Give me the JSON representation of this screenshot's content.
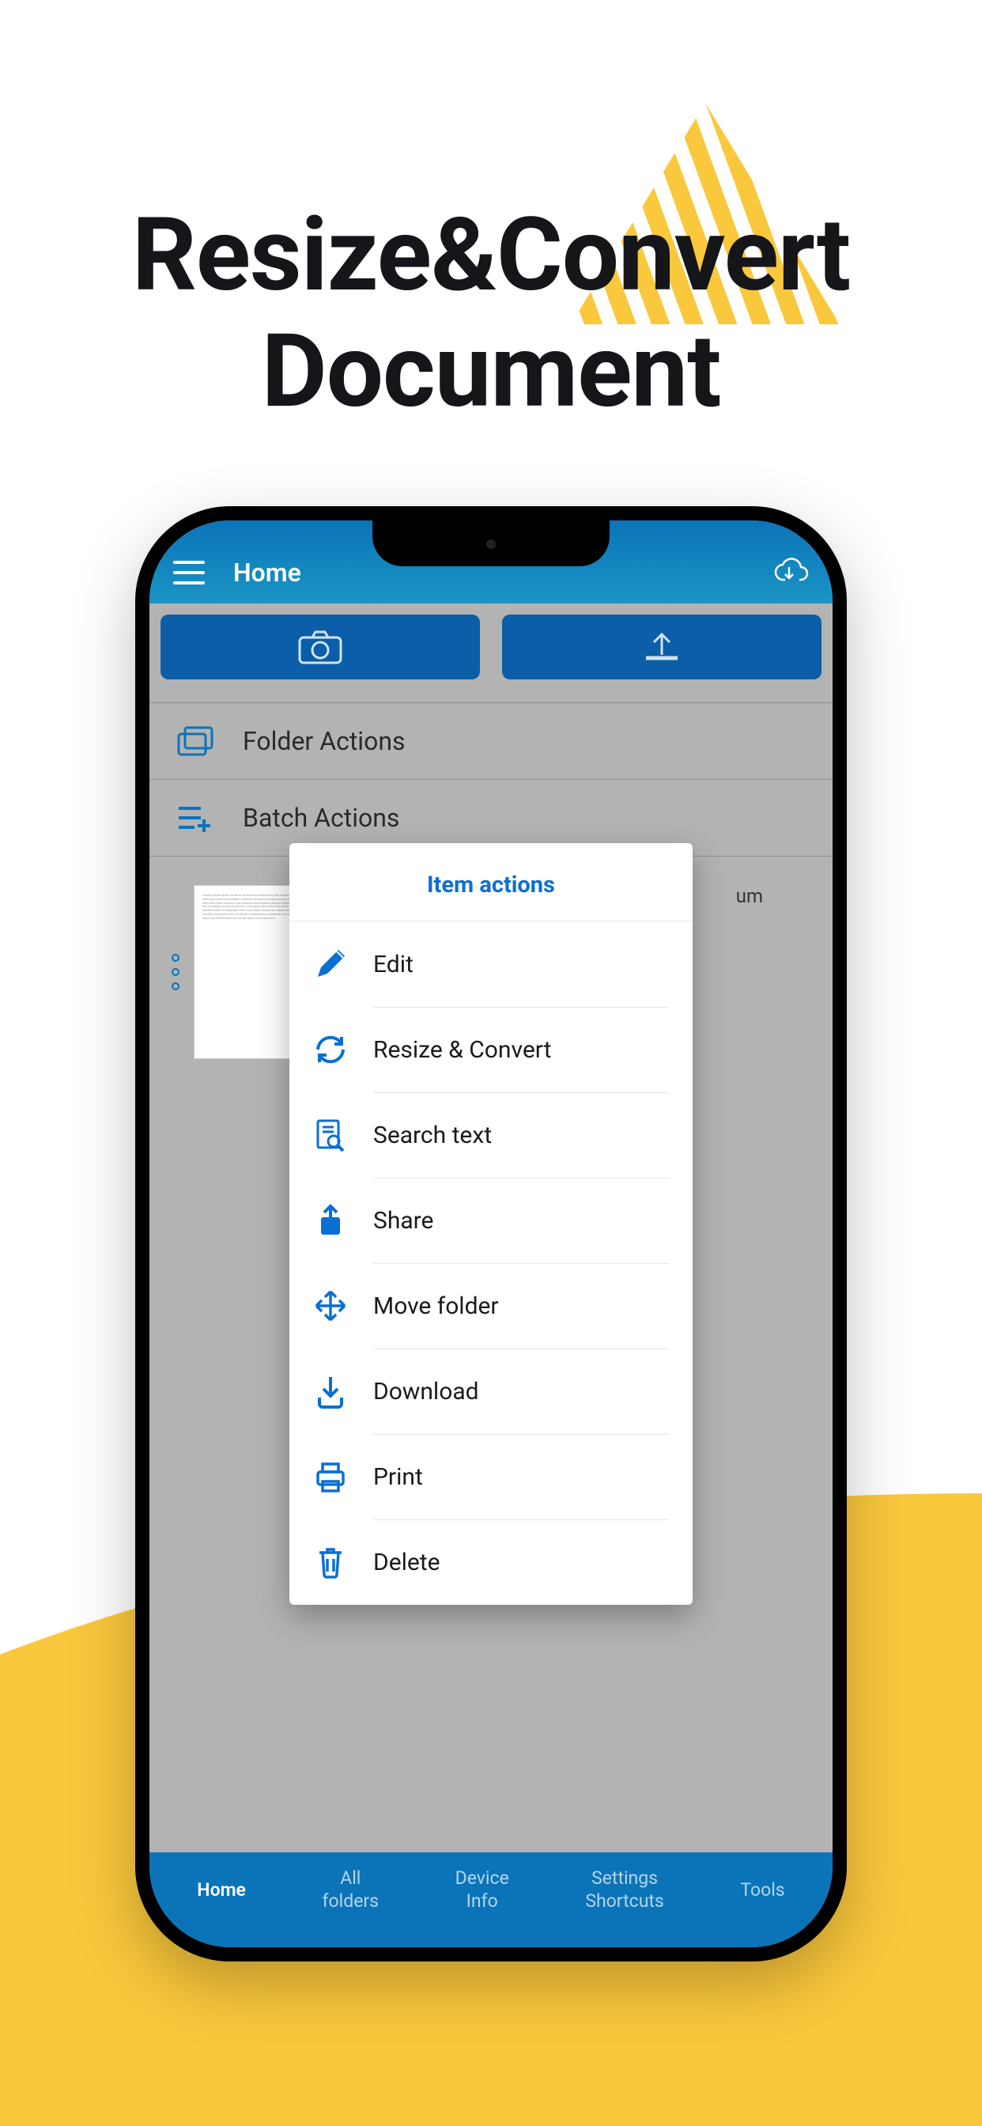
{
  "marketing": {
    "headline_line1": "Resize&Convert",
    "headline_line2": "Document"
  },
  "header": {
    "title": "Home"
  },
  "quick_rows": {
    "folder_actions": "Folder Actions",
    "batch_actions": "Batch Actions"
  },
  "doc_preview": {
    "snippet_suffix": "um"
  },
  "popup": {
    "title": "Item actions",
    "items": [
      {
        "id": "edit",
        "label": "Edit"
      },
      {
        "id": "resize_convert",
        "label": "Resize & Convert"
      },
      {
        "id": "search_text",
        "label": "Search text"
      },
      {
        "id": "share",
        "label": "Share"
      },
      {
        "id": "move_folder",
        "label": "Move folder"
      },
      {
        "id": "download",
        "label": "Download"
      },
      {
        "id": "print",
        "label": "Print"
      },
      {
        "id": "delete",
        "label": "Delete"
      }
    ]
  },
  "bottom_nav": {
    "home": "Home",
    "all_folders_l1": "All",
    "all_folders_l2": "folders",
    "device_info_l1": "Device",
    "device_info_l2": "Info",
    "settings_l1": "Settings",
    "settings_l2": "Shortcuts",
    "tools": "Tools"
  },
  "colors": {
    "brand_blue": "#0b74b8",
    "accent_yellow": "#fac83c",
    "popup_title": "#0a6fd3"
  }
}
